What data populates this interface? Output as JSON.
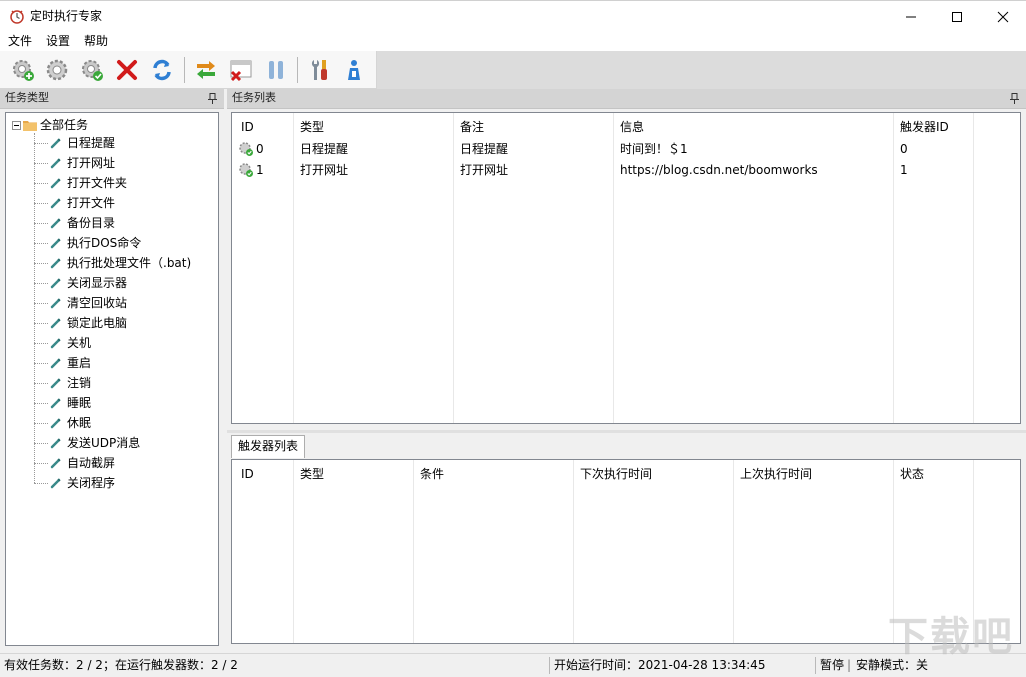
{
  "window": {
    "title": "定时执行专家",
    "controls": {
      "minimize": "minimize-icon",
      "maximize": "maximize-icon",
      "close": "close-icon"
    }
  },
  "menu": {
    "items": [
      "文件",
      "设置",
      "帮助"
    ]
  },
  "toolbar": {
    "buttons": [
      {
        "name": "add-task",
        "icon": "gear-add-icon"
      },
      {
        "name": "edit-task",
        "icon": "gear-icon"
      },
      {
        "name": "enable-task",
        "icon": "gear-check-icon"
      },
      {
        "name": "delete-task",
        "icon": "red-x-icon"
      },
      {
        "name": "refresh",
        "icon": "refresh-icon"
      },
      {
        "name": "switch",
        "icon": "swap-arrows-icon"
      },
      {
        "name": "close-window",
        "icon": "window-close-icon"
      },
      {
        "name": "pause",
        "icon": "pause-icon"
      },
      {
        "name": "tools",
        "icon": "tools-icon"
      },
      {
        "name": "about",
        "icon": "info-person-icon"
      }
    ]
  },
  "left_panel": {
    "caption": "任务类型",
    "root": "全部任务",
    "items": [
      "日程提醒",
      "打开网址",
      "打开文件夹",
      "打开文件",
      "备份目录",
      "执行DOS命令",
      "执行批处理文件（.bat)",
      "关闭显示器",
      "清空回收站",
      "锁定此电脑",
      "关机",
      "重启",
      "注销",
      "睡眠",
      "休眠",
      "发送UDP消息",
      "自动截屏",
      "关闭程序"
    ]
  },
  "task_panel": {
    "caption": "任务列表",
    "columns": [
      "ID",
      "类型",
      "备注",
      "信息",
      "触发器ID"
    ],
    "rows": [
      {
        "id": "0",
        "type": "日程提醒",
        "note": "日程提醒",
        "info": "时间到！＄1",
        "trigger_id": "0"
      },
      {
        "id": "1",
        "type": "打开网址",
        "note": "打开网址",
        "info": "https://blog.csdn.net/boomworks",
        "trigger_id": "1"
      }
    ]
  },
  "trigger_panel": {
    "tab": "触发器列表",
    "columns": [
      "ID",
      "类型",
      "条件",
      "下次执行时间",
      "上次执行时间",
      "状态"
    ]
  },
  "status": {
    "left": "有效任务数：2 / 2；在运行触发器数：2 / 2",
    "middle": "开始运行时间：2021-04-28 13:34:45",
    "pause": "暂停",
    "sep": "|",
    "quiet": "安静模式：关"
  },
  "watermark": "下载吧"
}
